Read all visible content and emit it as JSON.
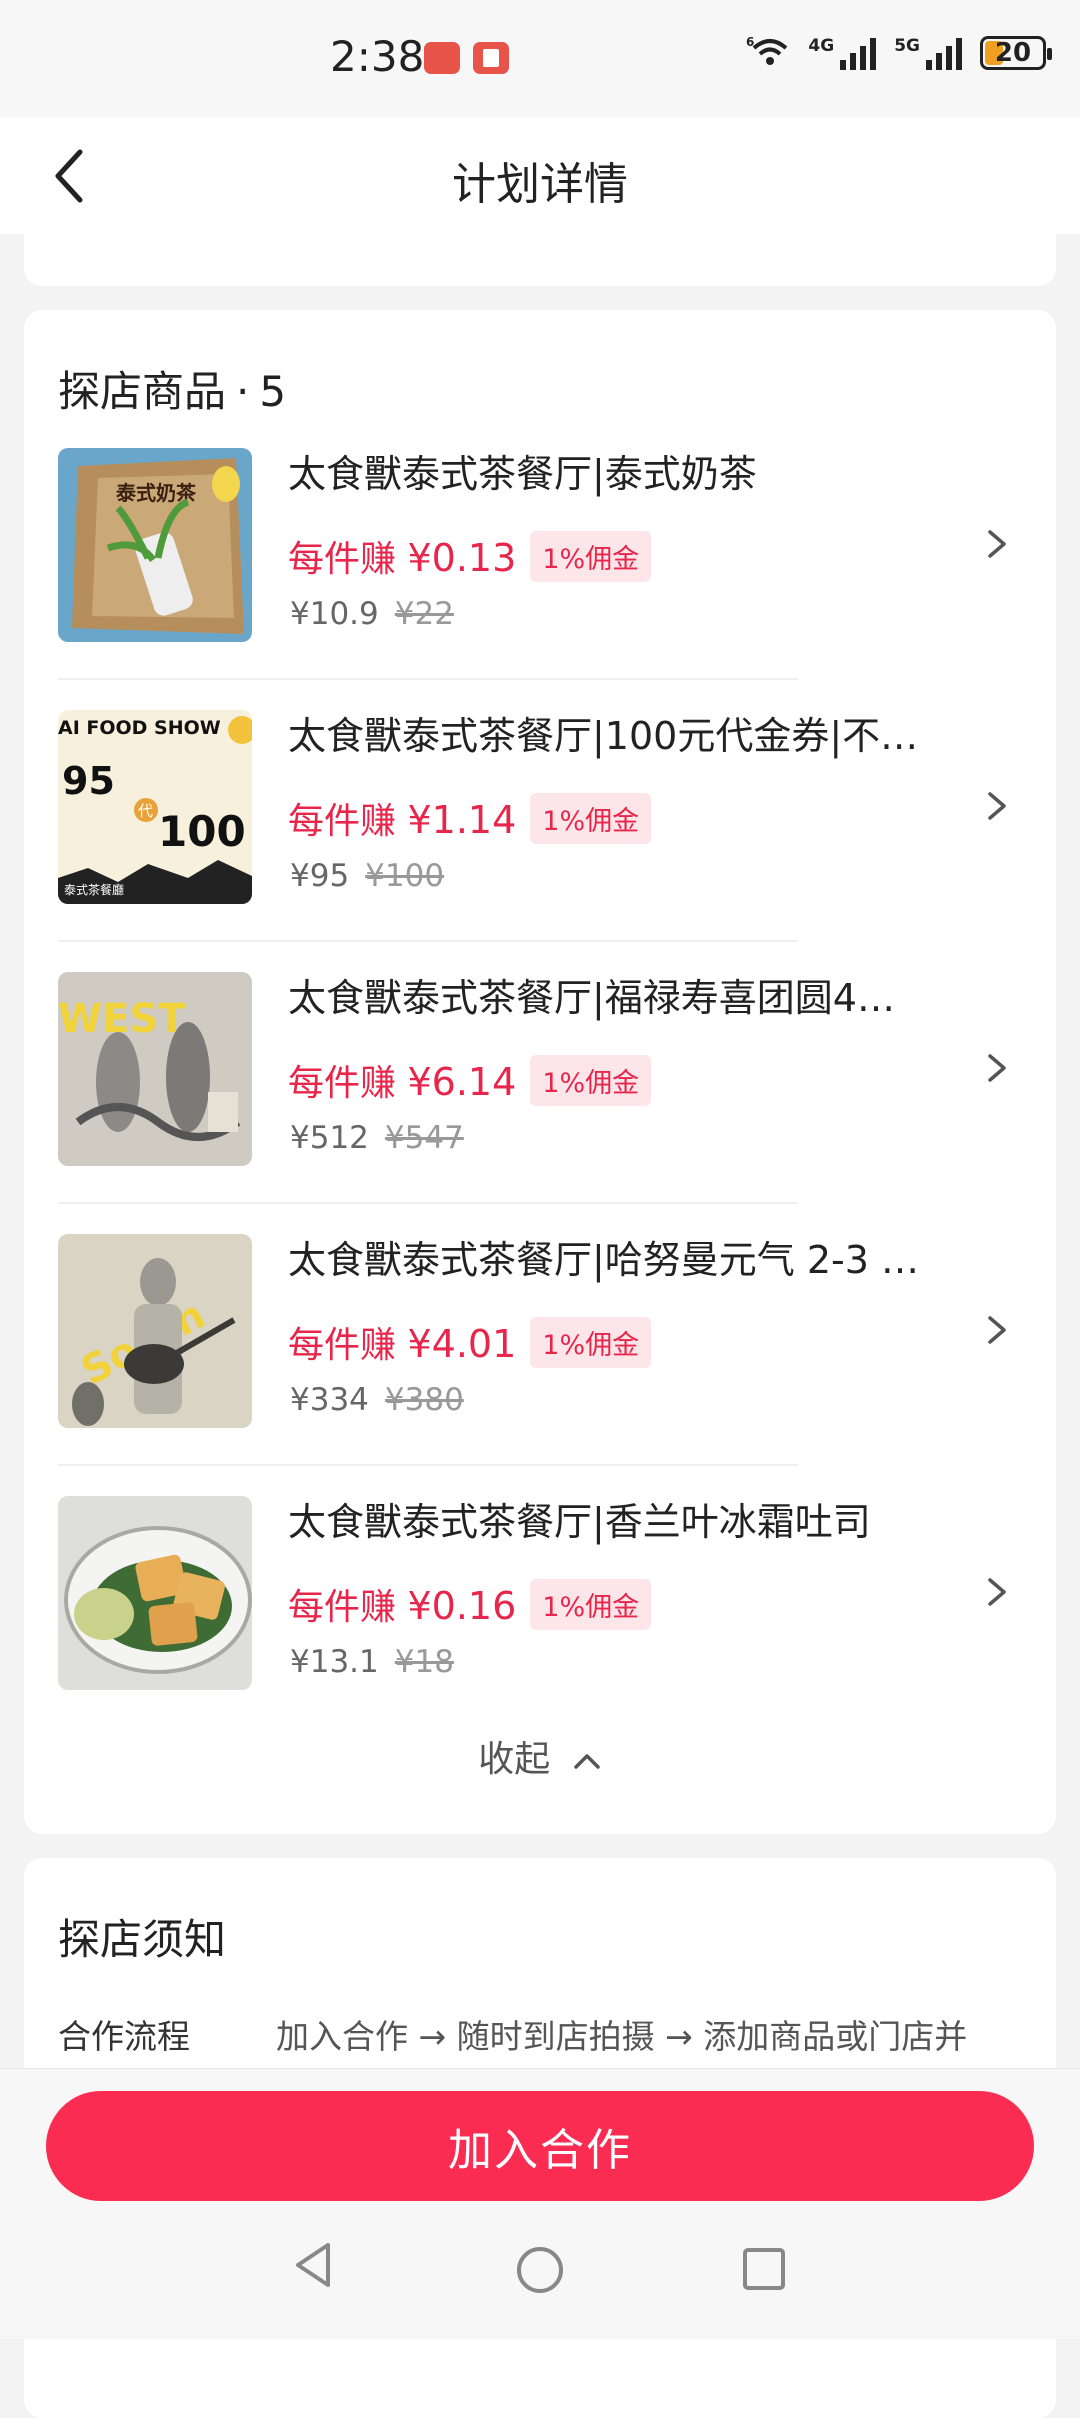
{
  "status_bar": {
    "time": "2:38",
    "battery": "20",
    "wifi_label": "6",
    "net1": "4G",
    "net2": "5G"
  },
  "header": {
    "title": "计划详情"
  },
  "products_section": {
    "title": "探店商品",
    "count": "5",
    "items": [
      {
        "name": "太食獸泰式茶餐厅|泰式奶茶",
        "earn_label": "每件赚",
        "earn_amount": "¥0.13",
        "commission": "1%佣金",
        "price": "¥10.9",
        "original_price": "¥22",
        "thumb_text": "泰式奶茶"
      },
      {
        "name": "太食獸泰式茶餐厅|100元代金券|不…",
        "earn_label": "每件赚",
        "earn_amount": "¥1.14",
        "commission": "1%佣金",
        "price": "¥95",
        "original_price": "¥100",
        "thumb_text": "AI FOOD SHOW"
      },
      {
        "name": "太食獸泰式茶餐厅|福禄寿喜团圆4…",
        "earn_label": "每件赚",
        "earn_amount": "¥6.14",
        "commission": "1%佣金",
        "price": "¥512",
        "original_price": "¥547",
        "thumb_text": "WEST"
      },
      {
        "name": "太食獸泰式茶餐厅|哈努曼元气 2-3 …",
        "earn_label": "每件赚",
        "earn_amount": "¥4.01",
        "commission": "1%佣金",
        "price": "¥334",
        "original_price": "¥380",
        "thumb_text": "South"
      },
      {
        "name": "太食獸泰式茶餐厅|香兰叶冰霜吐司",
        "earn_label": "每件赚",
        "earn_amount": "¥0.16",
        "commission": "1%佣金",
        "price": "¥13.1",
        "original_price": "¥18",
        "thumb_text": ""
      }
    ],
    "collapse_label": "收起"
  },
  "notice_section": {
    "title": "探店须知",
    "rows": [
      {
        "label": "合作流程",
        "value": "加入合作 → 随时到店拍摄 → 添加商品或门店并"
      }
    ]
  },
  "bottom": {
    "join_label": "加入合作"
  },
  "colors": {
    "accent": "#fb2c52",
    "earn": "#e8264b"
  }
}
